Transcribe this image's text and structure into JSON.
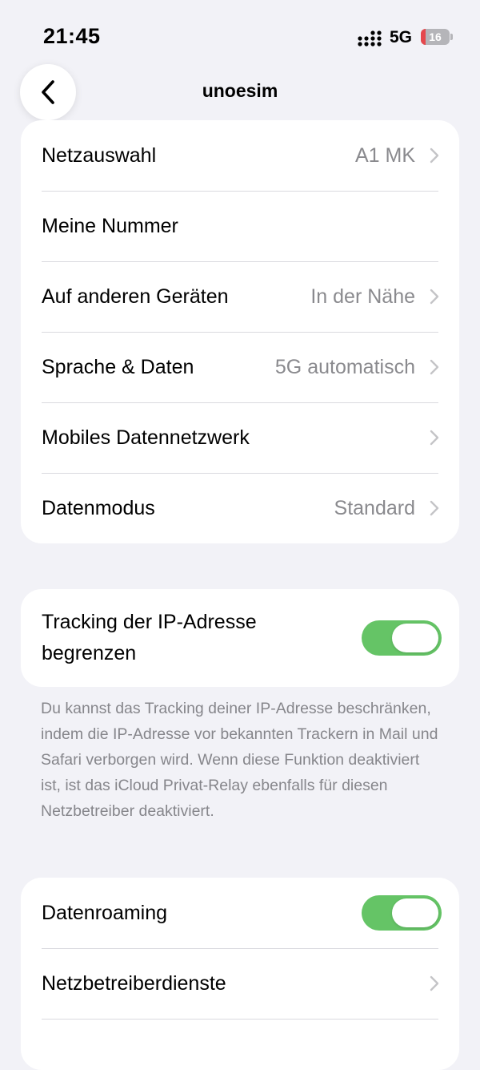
{
  "status_bar": {
    "time": "21:45",
    "network": "5G",
    "battery": "16",
    "battery_level": 0.16,
    "battery_fill_color": "#e5484d"
  },
  "nav": {
    "title": "unoesim",
    "back_icon": "chevron-left-icon"
  },
  "cellular_group": {
    "rows": [
      {
        "label": "Netzauswahl",
        "value": "A1 MK",
        "chevron": true
      },
      {
        "label": "Meine Nummer",
        "value": "",
        "chevron": false
      },
      {
        "label": "Auf anderen Geräten",
        "value": "In der Nähe",
        "chevron": true
      },
      {
        "label": "Sprache & Daten",
        "value": "5G automatisch",
        "chevron": true
      },
      {
        "label": "Mobiles Datennetzwerk",
        "value": "",
        "chevron": true
      },
      {
        "label": "Datenmodus",
        "value": "Standard",
        "chevron": true
      }
    ]
  },
  "ip_tracking": {
    "label": "Tracking der IP-Adresse begrenzen",
    "enabled": true,
    "footnote": "Du kannst das Tracking deiner IP-Adresse beschränken, indem die IP-Adresse vor bekannten Trackern in Mail und Safari verborgen wird. Wenn diese Funktion deaktiviert ist, ist das iCloud Privat-Relay ebenfalls für diesen Netzbetreiber deaktiviert."
  },
  "roaming_group": {
    "data_roaming_label": "Datenroaming",
    "data_roaming_enabled": true,
    "carrier_services_label": "Netzbetreiberdienste"
  },
  "colors": {
    "background": "#f2f2f7",
    "toggle_on": "#65c466",
    "secondary_text": "#8a8a8e"
  }
}
